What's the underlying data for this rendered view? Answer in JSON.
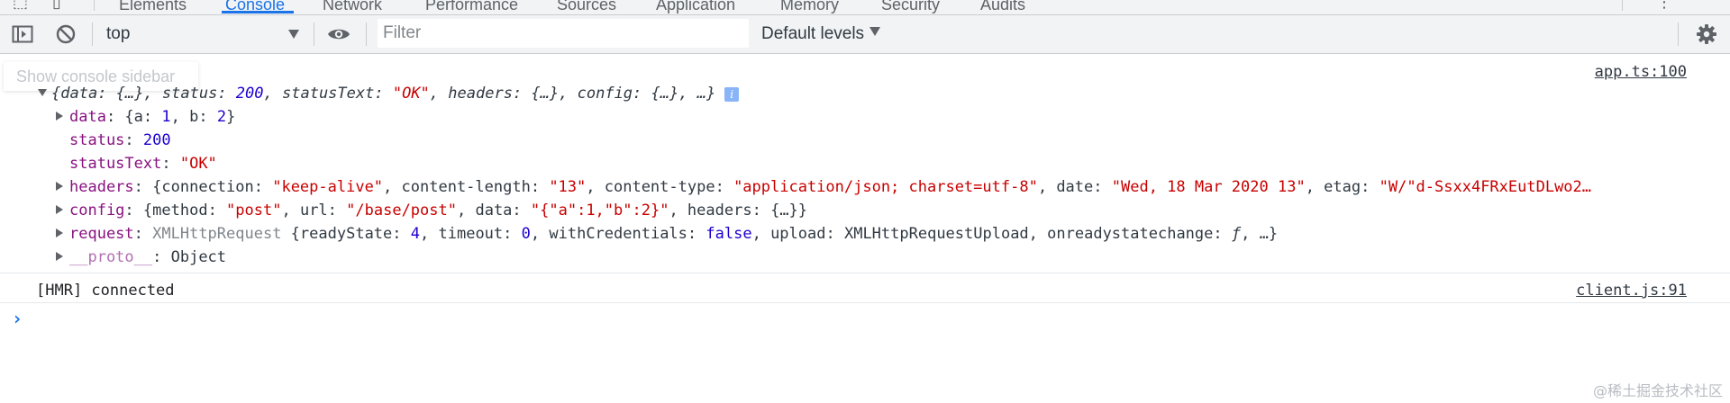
{
  "tabs": [
    {
      "label": "Elements"
    },
    {
      "label": "Console",
      "active": true
    },
    {
      "label": "Network"
    },
    {
      "label": "Performance"
    },
    {
      "label": "Sources"
    },
    {
      "label": "Application"
    },
    {
      "label": "Memory"
    },
    {
      "label": "Security"
    },
    {
      "label": "Audits"
    }
  ],
  "toolbar": {
    "context": "top",
    "filter_placeholder": "Filter",
    "filter_value": "",
    "levels": "Default levels",
    "icons": [
      "show-sidebar-icon",
      "clear-console-icon",
      "eye-icon",
      "gear-icon"
    ]
  },
  "tooltip": "Show console sidebar",
  "console": {
    "message1": {
      "source": "app.ts:100",
      "summary": {
        "open": "{",
        "data_key": "data",
        "data_val": "{…}",
        "status_key": "status",
        "status_val": "200",
        "statusText_key": "statusText",
        "statusText_val": "\"OK\"",
        "headers_key": "headers",
        "headers_val": "{…}",
        "config_key": "config",
        "config_val": "{…}",
        "tail": "…}"
      },
      "props": {
        "data_key": "data",
        "data_a_key": "a",
        "data_a_val": "1",
        "data_b_key": "b",
        "data_b_val": "2",
        "status_key": "status",
        "status_val": "200",
        "statusText_key": "statusText",
        "statusText_val": "\"OK\"",
        "headers_key": "headers",
        "h_connection_key": "connection",
        "h_connection_val": "\"keep-alive\"",
        "h_length_key": "content-length",
        "h_length_val": "\"13\"",
        "h_type_key": "content-type",
        "h_type_val": "\"application/json; charset=utf-8\"",
        "h_date_key": "date",
        "h_date_val": "\"Wed, 18 Mar 2020 13\"",
        "h_etag_key": "etag",
        "h_etag_val": "\"W/\"d-Ssxx4FRxEutDLwo2…",
        "config_key": "config",
        "c_method_key": "method",
        "c_method_val": "\"post\"",
        "c_url_key": "url",
        "c_url_val": "\"/base/post\"",
        "c_data_key": "data",
        "c_data_val": "\"{\"a\":1,\"b\":2}\"",
        "c_headers_key": "headers",
        "c_headers_val": "{…}",
        "request_key": "request",
        "request_class": "XMLHttpRequest",
        "r_ready_key": "readyState",
        "r_ready_val": "4",
        "r_timeout_key": "timeout",
        "r_timeout_val": "0",
        "r_cred_key": "withCredentials",
        "r_cred_val": "false",
        "r_upload_key": "upload",
        "r_upload_val": "XMLHttpRequestUpload",
        "r_onready_key": "onreadystatechange",
        "r_onready_val": "ƒ",
        "r_tail": "…}",
        "proto_key": "__proto__",
        "proto_val": "Object"
      }
    },
    "message2": {
      "text": "[HMR] connected",
      "source": "client.js:91"
    },
    "prompt": "›"
  },
  "watermark": "@稀土掘金技术社区"
}
